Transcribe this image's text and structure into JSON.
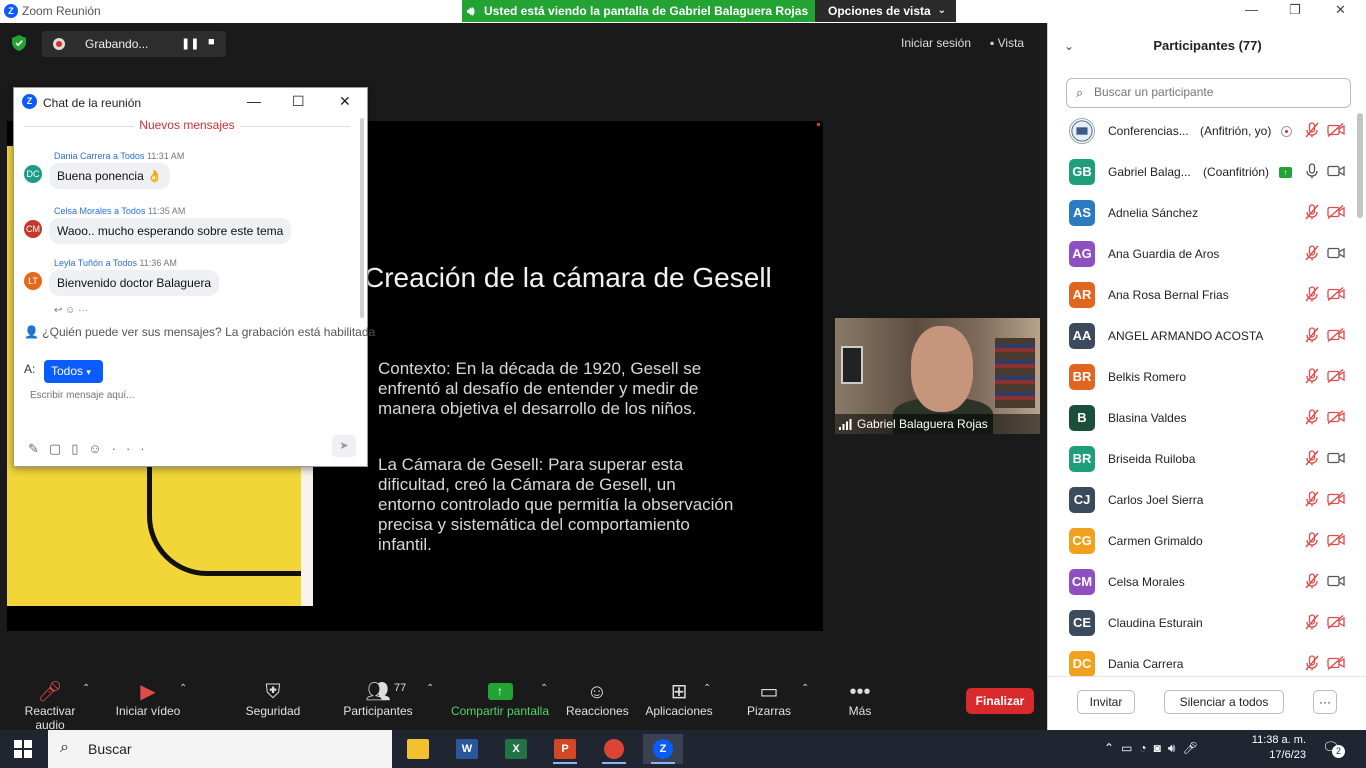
{
  "window": {
    "title": "Zoom Reunión",
    "viewing_banner": "Usted está viendo la pantalla de Gabriel Balaguera Rojas",
    "view_options": "Opciones de vista",
    "recording_label": "Grabando...",
    "signin": "Iniciar sesión",
    "view": "Vista"
  },
  "slide": {
    "title": "Creación de la cámara de Gesell",
    "paragraph1": "Contexto: En la década de 1920, Gesell se enfrentó al desafío de entender y medir de manera objetiva el desarrollo de los niños.",
    "paragraph2": "La Cámara de Gesell: Para superar esta dificultad, creó la Cámara de Gesell, un entorno controlado que permitía la observación precisa y sistemática del comportamiento infantil."
  },
  "speaker": {
    "name": "Gabriel Balaguera Rojas"
  },
  "chat": {
    "title": "Chat de la reunión",
    "new_messages": "Nuevos mensajes",
    "messages": [
      {
        "sender": "Dania Carrera",
        "to": "a",
        "recipient": "Todos",
        "time": "11:31 AM",
        "initials": "DC",
        "color": "#1e9c8a",
        "text": "Buena ponencia 👌"
      },
      {
        "sender": "Celsa Morales",
        "to": "a",
        "recipient": "Todos",
        "time": "11:35 AM",
        "initials": "CM",
        "color": "#c0392b",
        "text": "Waoo.. mucho esperando sobre este tema"
      },
      {
        "sender": "Leyla Tuñón",
        "to": "a",
        "recipient": "Todos",
        "time": "11:36 AM",
        "initials": "LT",
        "color": "#e36a1a",
        "text": "Bienvenido doctor Balaguera"
      }
    ],
    "visibility_note": "¿Quién puede ver sus mensajes? La grabación está habilitada",
    "to_label": "A:",
    "to_value": "Todos",
    "input_placeholder": "Escribir mensaje aquí..."
  },
  "toolbar": {
    "unmute": "Reactivar audio",
    "start_video": "Iniciar vídeo",
    "security": "Seguridad",
    "participants": "Participantes",
    "participants_count": "77",
    "share_screen": "Compartir pantalla",
    "reactions": "Reacciones",
    "apps": "Aplicaciones",
    "whiteboards": "Pizarras",
    "more": "Más",
    "end": "Finalizar"
  },
  "participants": {
    "title": "Participantes (77)",
    "search_placeholder": "Buscar un participante",
    "list": [
      {
        "initials": "",
        "name": "Conferencias...",
        "role": "(Anfitrión, yo)",
        "color": "#ffffff",
        "mic": "muted",
        "cam": "off",
        "logo": true,
        "rec": true
      },
      {
        "initials": "GB",
        "name": "Gabriel Balag...",
        "role": "(Coanfitrión)",
        "color": "#1f9e7a",
        "mic": "on",
        "cam": "on",
        "cohost": true
      },
      {
        "initials": "AS",
        "name": "Adnelia Sánchez",
        "role": "",
        "color": "#2a7bc0",
        "mic": "muted",
        "cam": "off"
      },
      {
        "initials": "AG",
        "name": "Ana Guardia de Aros",
        "role": "",
        "color": "#8e4fc0",
        "mic": "muted",
        "cam": "on"
      },
      {
        "initials": "AR",
        "name": "Ana Rosa Bernal Frias",
        "role": "",
        "color": "#e0651e",
        "mic": "muted",
        "cam": "off"
      },
      {
        "initials": "AA",
        "name": "ANGEL ARMANDO ACOSTA",
        "role": "",
        "color": "#3b4a5c",
        "mic": "muted",
        "cam": "off"
      },
      {
        "initials": "BR",
        "name": "Belkis Romero",
        "role": "",
        "color": "#e0651e",
        "mic": "muted",
        "cam": "off"
      },
      {
        "initials": "B",
        "name": "Blasina Valdes",
        "role": "",
        "color": "#1c4f3a",
        "mic": "muted",
        "cam": "off"
      },
      {
        "initials": "BR",
        "name": "Briseida Ruiloba",
        "role": "",
        "color": "#1f9e7a",
        "mic": "muted",
        "cam": "on"
      },
      {
        "initials": "CJ",
        "name": "Carlos Joel Sierra",
        "role": "",
        "color": "#3b4a5c",
        "mic": "muted",
        "cam": "off"
      },
      {
        "initials": "CG",
        "name": "Carmen Grimaldo",
        "role": "",
        "color": "#f0a21e",
        "mic": "muted",
        "cam": "off"
      },
      {
        "initials": "CM",
        "name": "Celsa Morales",
        "role": "",
        "color": "#8e4fc0",
        "mic": "muted",
        "cam": "on"
      },
      {
        "initials": "CE",
        "name": "Claudina Esturain",
        "role": "",
        "color": "#3b4a5c",
        "mic": "muted",
        "cam": "off"
      },
      {
        "initials": "DC",
        "name": "Dania Carrera",
        "role": "",
        "color": "#f0a21e",
        "mic": "muted",
        "cam": "off"
      }
    ],
    "invite": "Invitar",
    "mute_all": "Silenciar a todos",
    "more": "···"
  },
  "taskbar": {
    "search": "Buscar",
    "time": "11:38 a. m.",
    "date": "17/6/23",
    "notifications": "2"
  }
}
